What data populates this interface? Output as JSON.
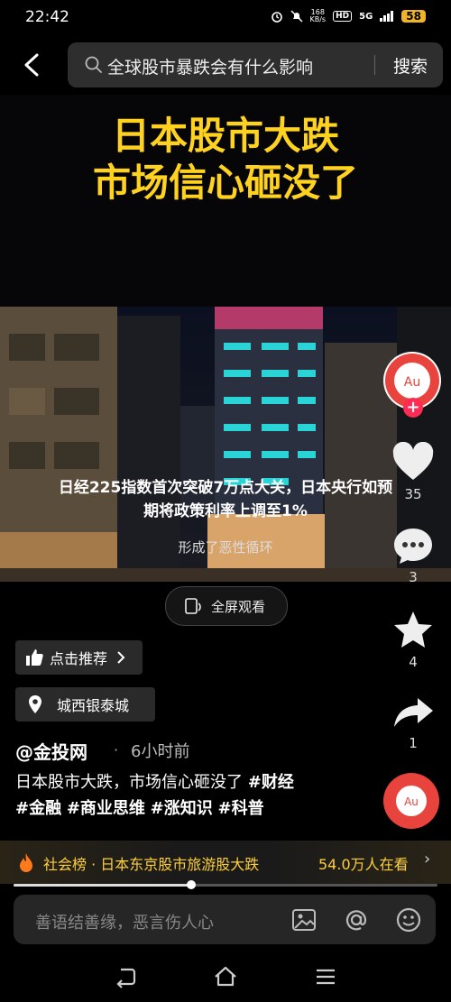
{
  "status": {
    "time": "22:42",
    "net_speed_top": "168",
    "net_speed_unit": "KB/s",
    "hd_label": "HD",
    "signal_label": "5G",
    "battery": "58"
  },
  "search": {
    "query": "全球股市暴跌会有什么影响",
    "button_label": "搜索"
  },
  "video": {
    "title_line1": "日本股市大跌",
    "title_line2": "市场信心砸没了",
    "caption": "日经225指数首次突破7万点大关，日本央行如预期将政策利率上调至1%",
    "subtitle": "形成了恶性循环"
  },
  "fullscreen": {
    "label": "全屏观看"
  },
  "rail": {
    "avatar_text": "Au",
    "likes": "35",
    "comments": "3",
    "favorites": "4",
    "shares": "1"
  },
  "chips": {
    "recommend": "点击推荐",
    "location": "城西银泰城"
  },
  "post": {
    "author": "@金投网",
    "separator": "·",
    "time_ago": "6小时前",
    "desc_text": "日本股市大跌，市场信心砸没了",
    "tags": [
      "#财经",
      "#金融",
      "#商业思维",
      "#涨知识",
      "#科普"
    ]
  },
  "hot": {
    "text": "社会榜 · 日本东京股市旅游股大跌",
    "count": "54.0万人在看"
  },
  "progress": {
    "fraction": 0.42
  },
  "comment": {
    "placeholder": "善语结善缘，恶言伤人心"
  },
  "colors": {
    "accent": "#ffd21f",
    "hot": "#ffcf3a",
    "brand_red": "#e8433c",
    "follow": "#ff2b55"
  },
  "icons": [
    "back-icon",
    "search-icon",
    "fullscreen-icon",
    "plus-icon",
    "heart-icon",
    "comment-icon",
    "star-icon",
    "share-icon",
    "thumb-up-icon",
    "location-pin-icon",
    "fire-icon",
    "chevron-right-icon",
    "image-icon",
    "at-icon",
    "emoji-icon",
    "nav-back-icon",
    "nav-home-icon",
    "nav-menu-icon"
  ]
}
